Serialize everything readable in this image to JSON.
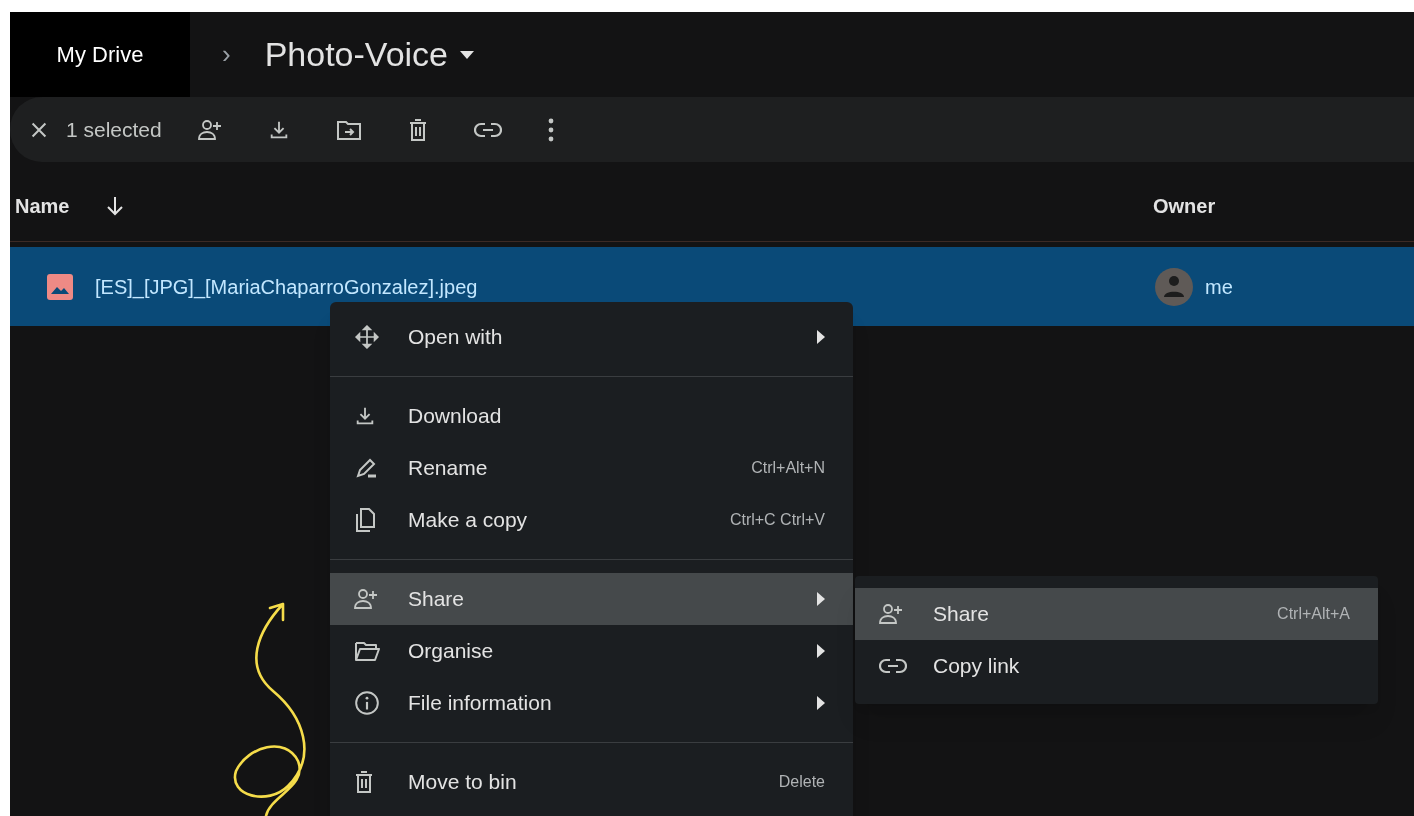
{
  "breadcrumb": {
    "root": "My Drive",
    "separator": "›",
    "folder": "Photo-Voice"
  },
  "toolbar": {
    "selection": "1 selected"
  },
  "columns": [
    {
      "label": "Name",
      "sorted": true
    },
    {
      "label": "Owner",
      "sorted": false
    }
  ],
  "rows": [
    {
      "name": "[ES]_[JPG]_[MariaChaparroGonzalez].jpeg",
      "owner": "me",
      "selected": true
    }
  ],
  "context_menu": [
    {
      "kind": "item",
      "label": "Open with",
      "submenu": true,
      "selected": false
    },
    {
      "kind": "separator"
    },
    {
      "kind": "item",
      "label": "Download",
      "submenu": false,
      "selected": false
    },
    {
      "kind": "item",
      "label": "Rename",
      "shortcut": "Ctrl+Alt+N",
      "submenu": false,
      "selected": false
    },
    {
      "kind": "item",
      "label": "Make a copy",
      "shortcut": "Ctrl+C Ctrl+V",
      "submenu": false,
      "selected": false
    },
    {
      "kind": "separator"
    },
    {
      "kind": "item",
      "label": "Share",
      "submenu": true,
      "selected": true
    },
    {
      "kind": "item",
      "label": "Organise",
      "submenu": true,
      "selected": false
    },
    {
      "kind": "item",
      "label": "File information",
      "submenu": true,
      "selected": false
    },
    {
      "kind": "separator"
    },
    {
      "kind": "item",
      "label": "Move to bin",
      "shortcut": "Delete",
      "submenu": false,
      "selected": false
    }
  ],
  "share_submenu": [
    {
      "label": "Share",
      "shortcut": "Ctrl+Alt+A",
      "selected": true
    },
    {
      "label": "Copy link",
      "selected": false
    }
  ]
}
